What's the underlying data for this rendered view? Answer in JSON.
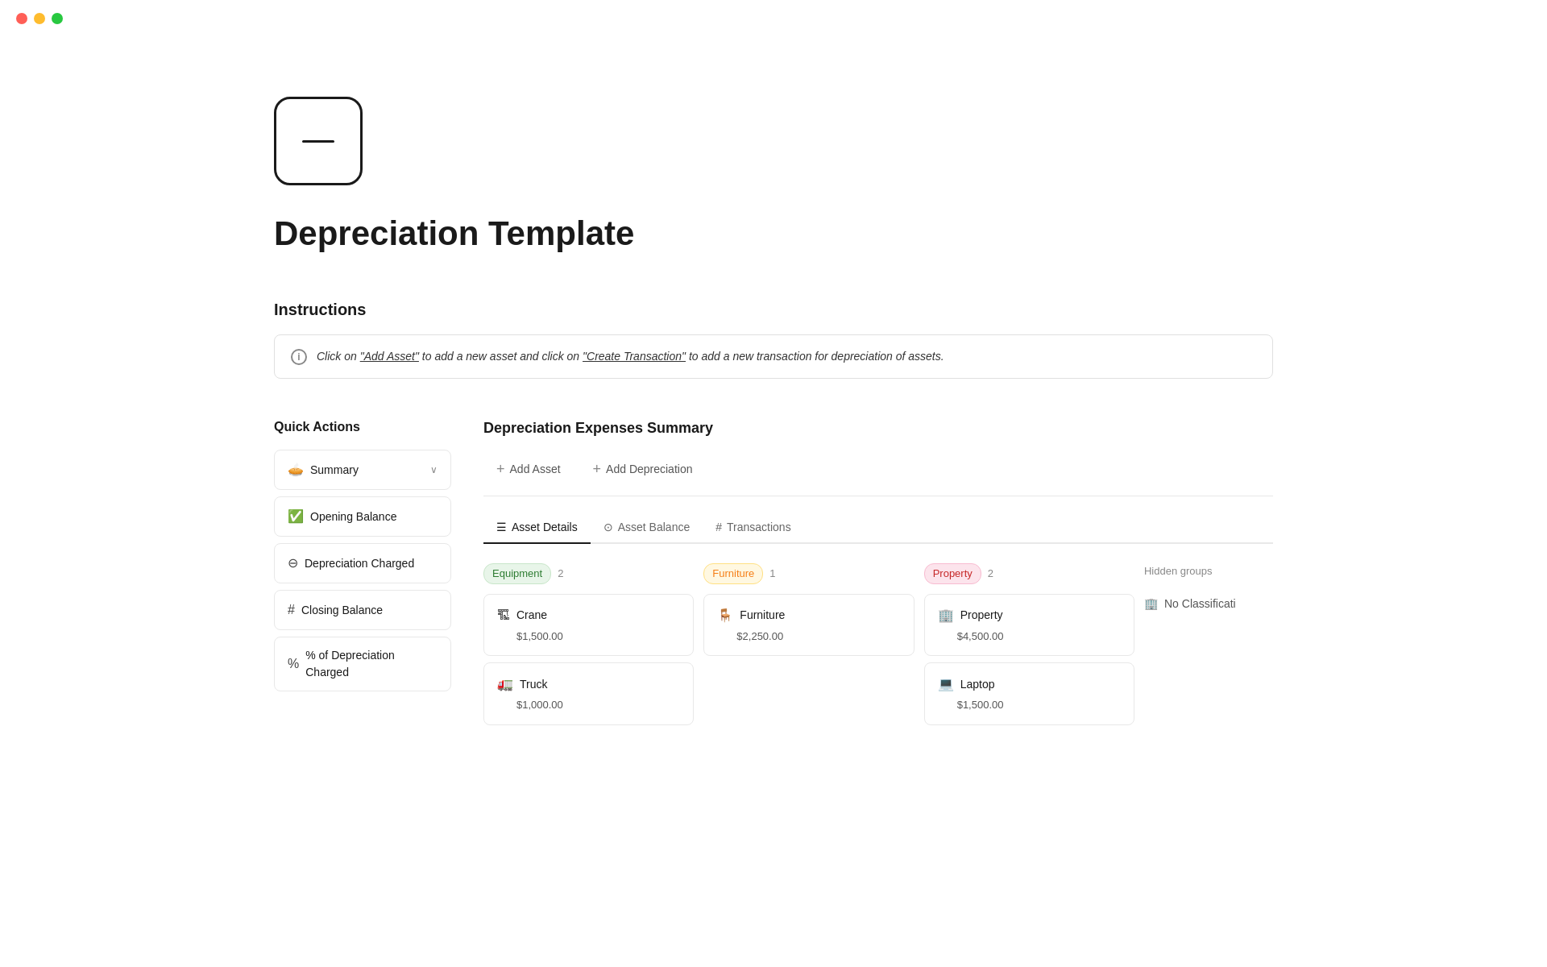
{
  "window": {
    "dots": [
      "red",
      "yellow",
      "green"
    ]
  },
  "page": {
    "icon_label": "minus icon",
    "title": "Depreciation Template",
    "instructions_label": "Instructions",
    "instructions_text": "Click on \"Add Asset\" to add a new asset and click on \"Create Transaction\" to add a new transaction for depreciation of assets.",
    "instructions_add_asset": "\"Add Asset\"",
    "instructions_create_transaction": "\"Create Transaction\""
  },
  "sidebar": {
    "title": "Quick Actions",
    "items": [
      {
        "id": "summary",
        "icon": "🥧",
        "label": "Summary",
        "chevron": true
      },
      {
        "id": "opening-balance",
        "icon": "✅",
        "label": "Opening Balance"
      },
      {
        "id": "depreciation-charged",
        "icon": "➖",
        "label": "Depreciation Charged"
      },
      {
        "id": "closing-balance",
        "icon": "#",
        "label": "Closing Balance"
      },
      {
        "id": "pct-depreciation",
        "icon": "%",
        "label": "% of Depreciation Charged"
      }
    ]
  },
  "main": {
    "section_title": "Depreciation Expenses Summary",
    "buttons": [
      {
        "id": "add-asset",
        "label": "Add Asset"
      },
      {
        "id": "add-depreciation",
        "label": "Add Depreciation"
      }
    ],
    "tabs": [
      {
        "id": "asset-details",
        "icon": "☰",
        "label": "Asset Details",
        "active": true
      },
      {
        "id": "asset-balance",
        "icon": "⊙",
        "label": "Asset Balance"
      },
      {
        "id": "transactions",
        "icon": "#",
        "label": "Transactions"
      }
    ],
    "groups": [
      {
        "id": "equipment",
        "badge_label": "Equipment",
        "badge_type": "equipment",
        "count": "2",
        "assets": [
          {
            "icon": "🏗",
            "name": "Crane",
            "value": "$1,500.00"
          },
          {
            "icon": "🚛",
            "name": "Truck",
            "value": "$1,000.00"
          }
        ]
      },
      {
        "id": "furniture",
        "badge_label": "Furniture",
        "badge_type": "furniture",
        "count": "1",
        "assets": [
          {
            "icon": "🪑",
            "name": "Furniture",
            "value": "$2,250.00"
          }
        ]
      },
      {
        "id": "property",
        "badge_label": "Property",
        "badge_type": "property",
        "count": "2",
        "assets": [
          {
            "icon": "🏢",
            "name": "Property",
            "value": "$4,500.00"
          },
          {
            "icon": "💻",
            "name": "Laptop",
            "value": "$1,500.00"
          }
        ]
      }
    ],
    "hidden_groups": {
      "label": "Hidden groups",
      "items": [
        {
          "icon": "🏢",
          "label": "No Classificati"
        }
      ]
    }
  }
}
